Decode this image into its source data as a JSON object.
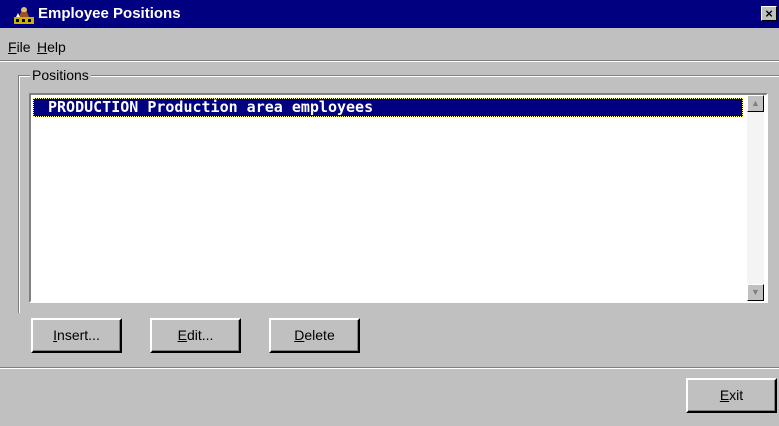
{
  "window": {
    "title": "Employee Positions",
    "icon": "app-icon",
    "close_label": "×"
  },
  "menu": {
    "file": {
      "accel": "F",
      "rest": "ile"
    },
    "help": {
      "accel": "H",
      "rest": "elp"
    }
  },
  "positions_group": {
    "label": "Positions",
    "items": [
      {
        "code": "PRODUCTION",
        "description": "Production area employees",
        "selected": true
      }
    ],
    "scroll_up_icon": "scroll-up-arrow-icon",
    "scroll_down_icon": "scroll-down-arrow-icon"
  },
  "buttons": {
    "insert": {
      "accel": "I",
      "rest": "nsert..."
    },
    "edit": {
      "accel": "E",
      "rest": "dit..."
    },
    "delete": {
      "accel": "D",
      "rest": "elete"
    },
    "exit": {
      "accel": "E",
      "rest": "xit"
    }
  },
  "colors": {
    "titlebar": "#000080",
    "selection": "#000080",
    "face": "#c0c0c0"
  }
}
